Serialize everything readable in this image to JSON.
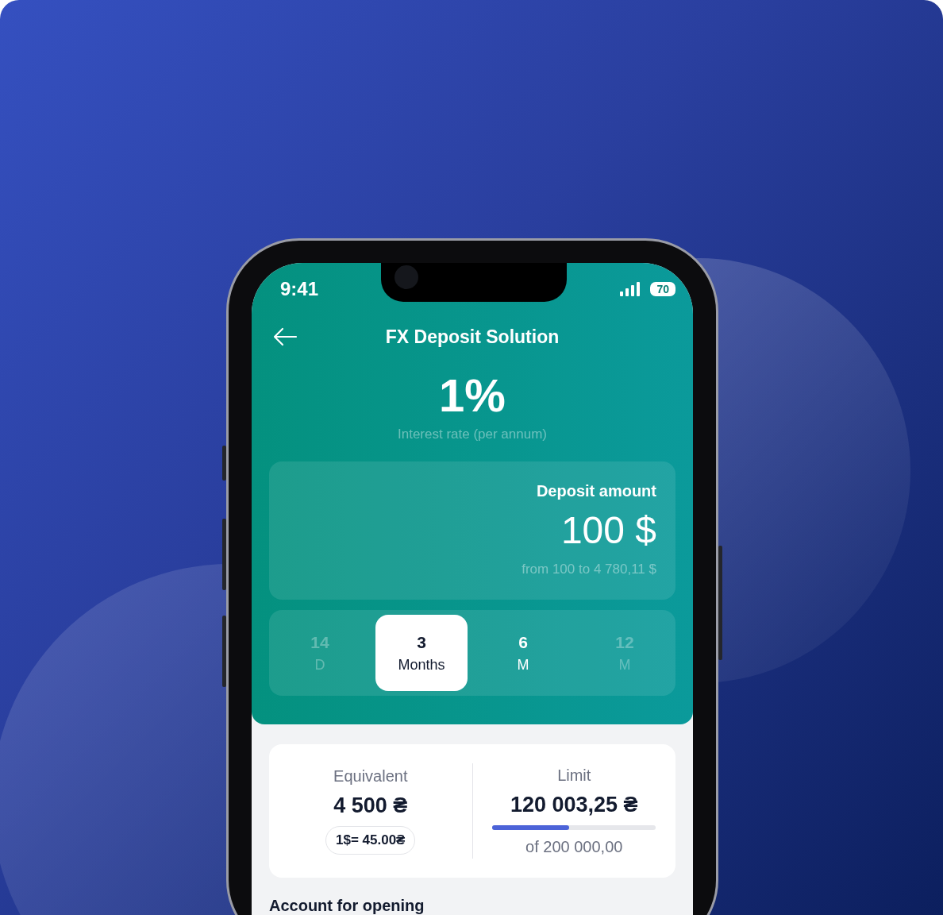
{
  "status_bar": {
    "time": "9:41",
    "battery": "70"
  },
  "header": {
    "title": "FX Deposit Solution"
  },
  "rate": {
    "value": "1%",
    "caption": "Interest rate (per annum)"
  },
  "deposit": {
    "label": "Deposit amount",
    "amount": "100 $",
    "range": "from 100 to 4 780,11 $"
  },
  "periods": [
    {
      "number": "14",
      "unit": "D",
      "selected": false,
      "disabled": true
    },
    {
      "number": "3",
      "unit": "Months",
      "selected": true,
      "disabled": false
    },
    {
      "number": "6",
      "unit": "M",
      "selected": false,
      "disabled": false
    },
    {
      "number": "12",
      "unit": "M",
      "selected": false,
      "disabled": true
    }
  ],
  "equivalent": {
    "label": "Equivalent",
    "amount": "4 500 ₴",
    "rate": "1$= 45.00₴"
  },
  "limit": {
    "label": "Limit",
    "amount": "120 003,25 ₴",
    "level": 0.47,
    "total": "of 200 000,00"
  },
  "section_title": "Account for opening"
}
